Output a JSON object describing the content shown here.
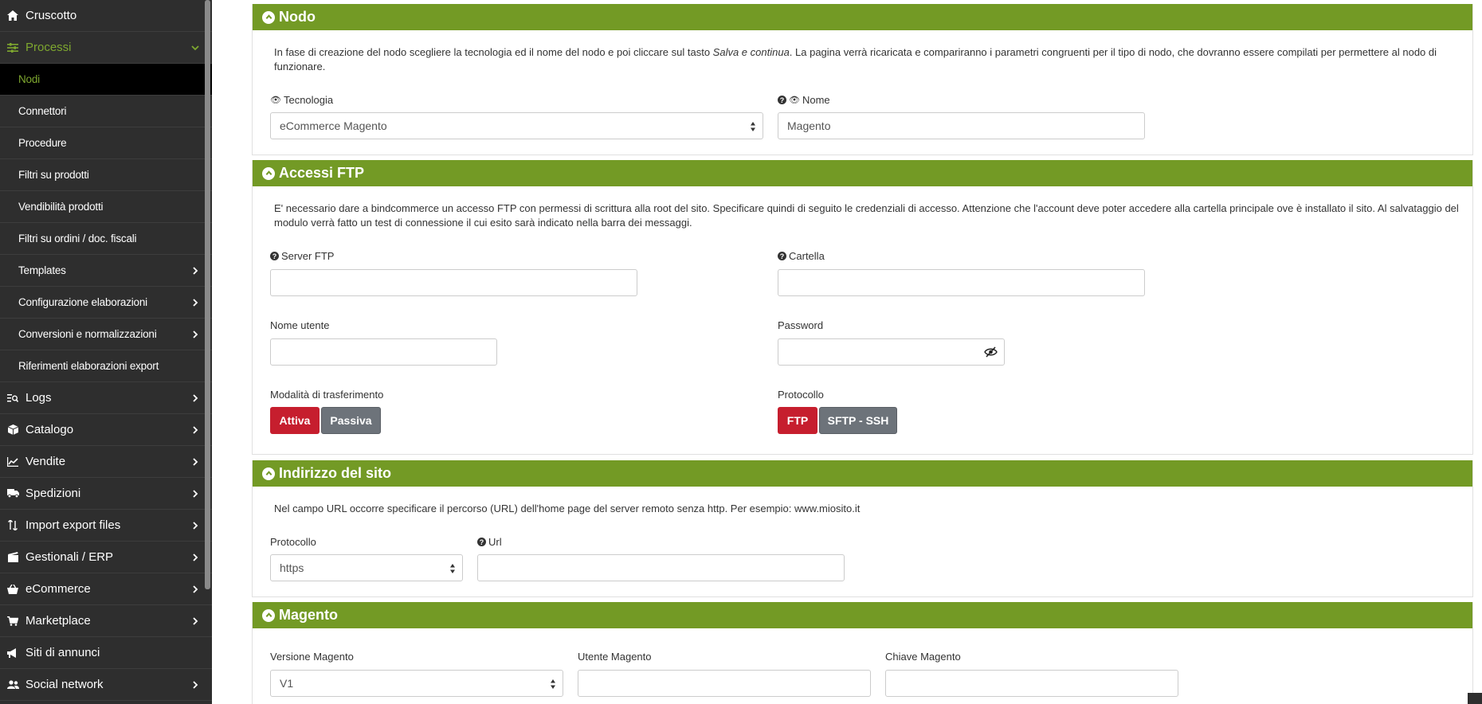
{
  "sidebar": {
    "items": [
      {
        "label": "Cruscotto"
      },
      {
        "label": "Processi"
      },
      {
        "label": "Nodi"
      },
      {
        "label": "Connettori"
      },
      {
        "label": "Procedure"
      },
      {
        "label": "Filtri su prodotti"
      },
      {
        "label": "Vendibilità prodotti"
      },
      {
        "label": "Filtri su ordini / doc. fiscali"
      },
      {
        "label": "Templates"
      },
      {
        "label": "Configurazione elaborazioni"
      },
      {
        "label": "Conversioni e normalizzazioni"
      },
      {
        "label": "Riferimenti elaborazioni export"
      },
      {
        "label": "Logs"
      },
      {
        "label": "Catalogo"
      },
      {
        "label": "Vendite"
      },
      {
        "label": "Spedizioni"
      },
      {
        "label": "Import export files"
      },
      {
        "label": "Gestionali / ERP"
      },
      {
        "label": "eCommerce"
      },
      {
        "label": "Marketplace"
      },
      {
        "label": "Siti di annunci"
      },
      {
        "label": "Social network"
      }
    ]
  },
  "nodo": {
    "title": "Nodo",
    "desc_a": "In fase di creazione del nodo scegliere la tecnologia ed il nome del nodo e poi cliccare sul tasto ",
    "desc_em": "Salva e continua",
    "desc_b": ". La pagina verrà ricaricata e compariranno i parametri congruenti per il tipo di nodo, che dovranno essere compilati per permettere al nodo di funzionare.",
    "tecnologia_label": "Tecnologia",
    "tecnologia_value": "eCommerce Magento",
    "nome_label": "Nome",
    "nome_value": "Magento"
  },
  "ftp": {
    "title": "Accessi FTP",
    "desc": "E' necessario dare a bindcommerce un accesso FTP con permessi di scrittura alla root del sito. Specificare quindi di seguito le credenziali di accesso. Attenzione che l'account deve poter accedere alla cartella principale ove è installato il sito. Al salvataggio del modulo verrà fatto un test di connessione il cui esito sarà indicato nella barra dei messaggi.",
    "server_label": "Server FTP",
    "cartella_label": "Cartella",
    "utente_label": "Nome utente",
    "password_label": "Password",
    "modalita_label": "Modalità di trasferimento",
    "attiva": "Attiva",
    "passiva": "Passiva",
    "protocollo_label": "Protocollo",
    "ftp": "FTP",
    "sftp": "SFTP - SSH"
  },
  "sito": {
    "title": "Indirizzo del sito",
    "desc": "Nel campo URL occorre specificare il percorso (URL) dell'home page del server remoto senza http. Per esempio: www.miosito.it",
    "protocollo_label": "Protocollo",
    "protocollo_value": "https",
    "url_label": "Url"
  },
  "magento": {
    "title": "Magento",
    "versione_label": "Versione Magento",
    "versione_value": "V1",
    "utente_label": "Utente Magento",
    "chiave_label": "Chiave Magento"
  },
  "colors": {
    "green": "#739a25",
    "red": "#c61e2e",
    "grey": "#6d737a",
    "sidebar": "#2e2e2e"
  }
}
